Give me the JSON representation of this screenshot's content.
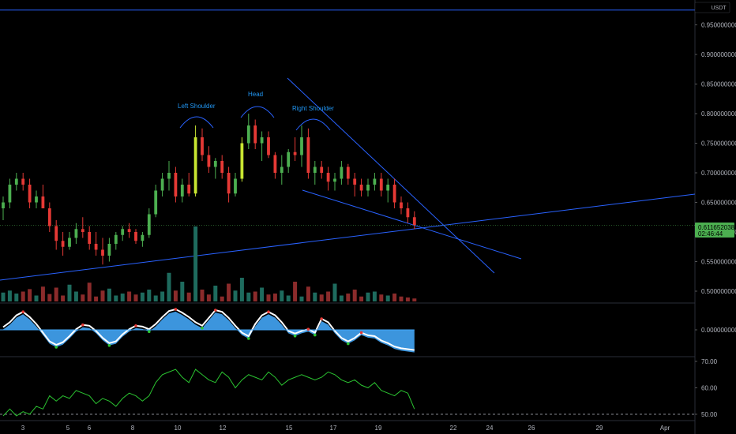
{
  "chart_data": [
    {
      "type": "candlestick",
      "quote_unit": "USDT",
      "yticks": [
        0.5,
        0.55,
        0.6,
        0.65,
        0.7,
        0.75,
        0.8,
        0.85,
        0.9,
        0.95,
        1.0
      ],
      "ytick_labels": [
        "0.5000000000",
        "0.5500000000",
        "0.6000000000",
        "0.6500000000",
        "0.7000000000",
        "0.7500000000",
        "0.8000000000",
        "0.8500000000",
        "0.9000000000",
        "0.9500000000",
        "1.0000000000"
      ],
      "ylim": [
        0.488,
        1.0
      ],
      "last_price": 0.6116520389,
      "last_price_label": "0.6116520389",
      "countdown_label": "02:46:44",
      "ohlc": [
        [
          0.64,
          0.66,
          0.62,
          0.65
        ],
        [
          0.65,
          0.69,
          0.64,
          0.68
        ],
        [
          0.68,
          0.7,
          0.67,
          0.69
        ],
        [
          0.69,
          0.7,
          0.67,
          0.68
        ],
        [
          0.68,
          0.69,
          0.64,
          0.65
        ],
        [
          0.65,
          0.67,
          0.64,
          0.66
        ],
        [
          0.66,
          0.68,
          0.64,
          0.64
        ],
        [
          0.64,
          0.65,
          0.6,
          0.61
        ],
        [
          0.61,
          0.62,
          0.57,
          0.585
        ],
        [
          0.585,
          0.6,
          0.56,
          0.575
        ],
        [
          0.575,
          0.6,
          0.57,
          0.59
        ],
        [
          0.59,
          0.615,
          0.58,
          0.605
        ],
        [
          0.605,
          0.625,
          0.59,
          0.6
        ],
        [
          0.6,
          0.61,
          0.57,
          0.58
        ],
        [
          0.58,
          0.6,
          0.56,
          0.57
        ],
        [
          0.57,
          0.59,
          0.545,
          0.56
        ],
        [
          0.56,
          0.59,
          0.55,
          0.58
        ],
        [
          0.58,
          0.6,
          0.57,
          0.595
        ],
        [
          0.595,
          0.61,
          0.585,
          0.605
        ],
        [
          0.605,
          0.615,
          0.59,
          0.6
        ],
        [
          0.6,
          0.605,
          0.58,
          0.585
        ],
        [
          0.585,
          0.6,
          0.575,
          0.595
        ],
        [
          0.595,
          0.64,
          0.59,
          0.63
        ],
        [
          0.63,
          0.68,
          0.625,
          0.67
        ],
        [
          0.67,
          0.7,
          0.66,
          0.69
        ],
        [
          0.69,
          0.72,
          0.67,
          0.7
        ],
        [
          0.7,
          0.71,
          0.65,
          0.66
        ],
        [
          0.66,
          0.69,
          0.65,
          0.68
        ],
        [
          0.68,
          0.7,
          0.66,
          0.665
        ],
        [
          0.665,
          0.78,
          0.66,
          0.76
        ],
        [
          0.76,
          0.775,
          0.72,
          0.73
        ],
        [
          0.73,
          0.745,
          0.7,
          0.71
        ],
        [
          0.71,
          0.725,
          0.69,
          0.72
        ],
        [
          0.72,
          0.73,
          0.69,
          0.7
        ],
        [
          0.7,
          0.71,
          0.65,
          0.665
        ],
        [
          0.665,
          0.7,
          0.66,
          0.69
        ],
        [
          0.69,
          0.76,
          0.685,
          0.75
        ],
        [
          0.75,
          0.8,
          0.74,
          0.78
        ],
        [
          0.78,
          0.79,
          0.74,
          0.75
        ],
        [
          0.75,
          0.77,
          0.72,
          0.76
        ],
        [
          0.76,
          0.77,
          0.725,
          0.73
        ],
        [
          0.73,
          0.735,
          0.69,
          0.7
        ],
        [
          0.7,
          0.73,
          0.68,
          0.71
        ],
        [
          0.71,
          0.74,
          0.7,
          0.735
        ],
        [
          0.735,
          0.76,
          0.72,
          0.73
        ],
        [
          0.73,
          0.78,
          0.71,
          0.76
        ],
        [
          0.76,
          0.775,
          0.69,
          0.7
        ],
        [
          0.7,
          0.72,
          0.68,
          0.71
        ],
        [
          0.71,
          0.72,
          0.69,
          0.7
        ],
        [
          0.7,
          0.71,
          0.67,
          0.685
        ],
        [
          0.685,
          0.7,
          0.67,
          0.69
        ],
        [
          0.69,
          0.72,
          0.68,
          0.71
        ],
        [
          0.71,
          0.715,
          0.68,
          0.69
        ],
        [
          0.69,
          0.7,
          0.66,
          0.68
        ],
        [
          0.68,
          0.69,
          0.66,
          0.67
        ],
        [
          0.67,
          0.69,
          0.66,
          0.68
        ],
        [
          0.68,
          0.7,
          0.67,
          0.69
        ],
        [
          0.69,
          0.7,
          0.66,
          0.67
        ],
        [
          0.67,
          0.69,
          0.65,
          0.68
        ],
        [
          0.68,
          0.69,
          0.64,
          0.65
        ],
        [
          0.65,
          0.66,
          0.63,
          0.64
        ],
        [
          0.64,
          0.65,
          0.615,
          0.625
        ],
        [
          0.625,
          0.635,
          0.605,
          0.612
        ]
      ],
      "volume": [
        18,
        22,
        16,
        20,
        25,
        12,
        30,
        15,
        28,
        12,
        34,
        20,
        14,
        38,
        10,
        22,
        26,
        12,
        16,
        20,
        14,
        18,
        24,
        12,
        20,
        58,
        22,
        40,
        18,
        152,
        24,
        14,
        32,
        10,
        36,
        22,
        48,
        18,
        20,
        28,
        14,
        16,
        22,
        12,
        40,
        10,
        30,
        18,
        14,
        20,
        36,
        12,
        16,
        24,
        10,
        18,
        20,
        14,
        12,
        16,
        10,
        8,
        6
      ]
    },
    {
      "type": "histogram",
      "ytick_labels": [
        "0.0000000000"
      ],
      "values": [
        0.02,
        0.3,
        0.7,
        0.9,
        0.6,
        0.2,
        -0.3,
        -0.8,
        -1.0,
        -0.85,
        -0.5,
        -0.1,
        0.15,
        0.1,
        -0.2,
        -0.6,
        -0.9,
        -0.8,
        -0.4,
        -0.1,
        0.1,
        0.05,
        -0.1,
        0.2,
        0.6,
        0.95,
        1.05,
        0.85,
        0.6,
        0.3,
        0.1,
        0.55,
        1.0,
        0.9,
        0.55,
        0.1,
        -0.3,
        -0.5,
        0.2,
        0.7,
        0.9,
        0.7,
        0.3,
        -0.2,
        -0.35,
        -0.2,
        -0.1,
        -0.3,
        0.5,
        0.3,
        -0.2,
        -0.6,
        -0.8,
        -0.6,
        -0.3,
        -0.45,
        -0.5,
        -0.75,
        -0.9,
        -1.1,
        -1.2,
        -1.25,
        -1.3
      ]
    },
    {
      "type": "line",
      "yticks": [
        50,
        60,
        70
      ],
      "ytick_labels": [
        "50.00",
        "60.00",
        "70.00"
      ],
      "ylim": [
        49.4,
        71.5
      ],
      "reference_line": 50,
      "values": [
        48,
        52,
        49,
        51,
        50,
        53,
        52,
        57,
        55,
        57,
        56,
        59,
        58,
        57,
        54,
        56,
        55,
        53,
        56,
        58,
        57,
        55,
        57,
        62,
        65,
        66,
        67,
        64,
        62,
        67,
        65,
        63,
        62,
        66,
        64,
        60,
        63,
        65,
        64,
        63,
        66,
        64,
        61,
        63,
        64,
        65,
        64,
        63,
        64,
        66,
        65,
        63,
        62,
        63,
        61,
        60,
        62,
        59,
        58,
        57,
        59,
        58,
        52
      ]
    }
  ],
  "x_axis_labels": [
    "3",
    "5",
    "6",
    "8",
    "10",
    "12",
    "15",
    "17",
    "19",
    "22",
    "24",
    "26",
    "29",
    "Apr"
  ],
  "annotations": [
    "Left Shoulder",
    "Head",
    "Right Shoulder"
  ],
  "colors": {
    "up": "#4caf50",
    "down": "#e53935",
    "up_vol": "#1e6b5e",
    "down_vol": "#8b2b2b",
    "highlight_up": "#c8e631",
    "trendline": "#2962ff",
    "histogram": "#42a5f5",
    "rsi": "#2bc431",
    "price_box": "#4caf50"
  }
}
